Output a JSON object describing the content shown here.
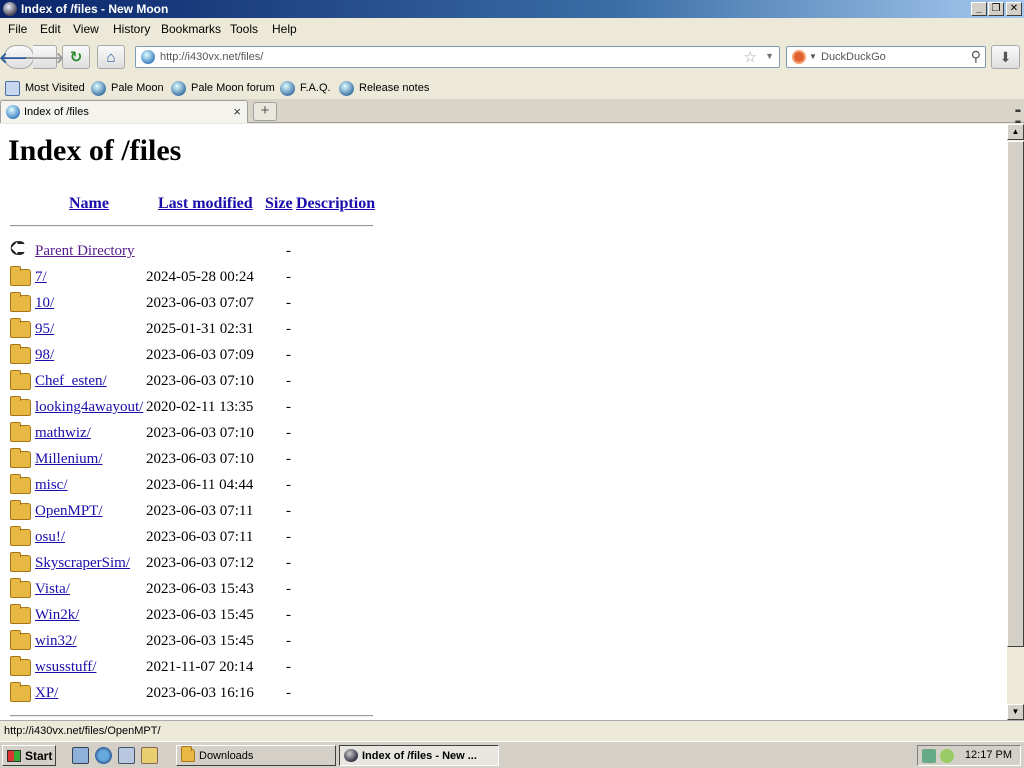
{
  "window": {
    "title": "Index of /files - New Moon",
    "min_label": "_",
    "max_label": "❐",
    "close_label": "✕"
  },
  "menubar": {
    "items": [
      {
        "label": "File"
      },
      {
        "label": "Edit"
      },
      {
        "label": "View"
      },
      {
        "label": "History"
      },
      {
        "label": "Bookmarks"
      },
      {
        "label": "Tools"
      },
      {
        "label": "Help"
      }
    ]
  },
  "navbar": {
    "url": "http://i430vx.net/files/",
    "search_placeholder": "DuckDuckGo"
  },
  "bookmarks": [
    {
      "label": "Most Visited",
      "icon": "most-visited-icon"
    },
    {
      "label": "Pale Moon",
      "icon": "pale-moon-icon"
    },
    {
      "label": "Pale Moon forum",
      "icon": "forum-icon"
    },
    {
      "label": "F.A.Q.",
      "icon": "pale-moon-icon"
    },
    {
      "label": "Release notes",
      "icon": "pale-moon-icon"
    }
  ],
  "tabs": [
    {
      "label": "Index of /files"
    }
  ],
  "page": {
    "title": "Index of /files",
    "columns": {
      "name": "Name",
      "modified": "Last modified",
      "size": "Size",
      "description": "Description"
    },
    "rows": [
      {
        "name": "Parent Directory",
        "date": "",
        "size": "-",
        "icon": "back-icon"
      },
      {
        "name": "7/",
        "date": "2024-05-28 00:24",
        "size": "-",
        "icon": "folder-icon"
      },
      {
        "name": "10/",
        "date": "2023-06-03 07:07",
        "size": "-",
        "icon": "folder-icon"
      },
      {
        "name": "95/",
        "date": "2025-01-31 02:31",
        "size": "-",
        "icon": "folder-icon"
      },
      {
        "name": "98/",
        "date": "2023-06-03 07:09",
        "size": "-",
        "icon": "folder-icon"
      },
      {
        "name": "Chef_esten/",
        "date": "2023-06-03 07:10",
        "size": "-",
        "icon": "folder-icon"
      },
      {
        "name": "looking4awayout/",
        "date": "2020-02-11 13:35",
        "size": "-",
        "icon": "folder-icon"
      },
      {
        "name": "mathwiz/",
        "date": "2023-06-03 07:10",
        "size": "-",
        "icon": "folder-icon"
      },
      {
        "name": "Millenium/",
        "date": "2023-06-03 07:10",
        "size": "-",
        "icon": "folder-icon"
      },
      {
        "name": "misc/",
        "date": "2023-06-11 04:44",
        "size": "-",
        "icon": "folder-icon"
      },
      {
        "name": "OpenMPT/",
        "date": "2023-06-03 07:11",
        "size": "-",
        "icon": "folder-icon"
      },
      {
        "name": "osu!/",
        "date": "2023-06-03 07:11",
        "size": "-",
        "icon": "folder-icon"
      },
      {
        "name": "SkyscraperSim/",
        "date": "2023-06-03 07:12",
        "size": "-",
        "icon": "folder-icon"
      },
      {
        "name": "Vista/",
        "date": "2023-06-03 15:43",
        "size": "-",
        "icon": "folder-icon"
      },
      {
        "name": "Win2k/",
        "date": "2023-06-03 15:45",
        "size": "-",
        "icon": "folder-icon"
      },
      {
        "name": "win32/",
        "date": "2023-06-03 15:45",
        "size": "-",
        "icon": "folder-icon"
      },
      {
        "name": "wsusstuff/",
        "date": "2021-11-07 20:14",
        "size": "-",
        "icon": "folder-icon"
      },
      {
        "name": "XP/",
        "date": "2023-06-03 16:16",
        "size": "-",
        "icon": "folder-icon"
      }
    ]
  },
  "statusbar": {
    "text": "http://i430vx.net/files/OpenMPT/"
  },
  "taskbar": {
    "start_label": "Start",
    "items": [
      {
        "label": "Downloads",
        "active": false
      },
      {
        "label": "Index of /files - New ...",
        "active": true
      }
    ],
    "clock": "12:17 PM"
  }
}
